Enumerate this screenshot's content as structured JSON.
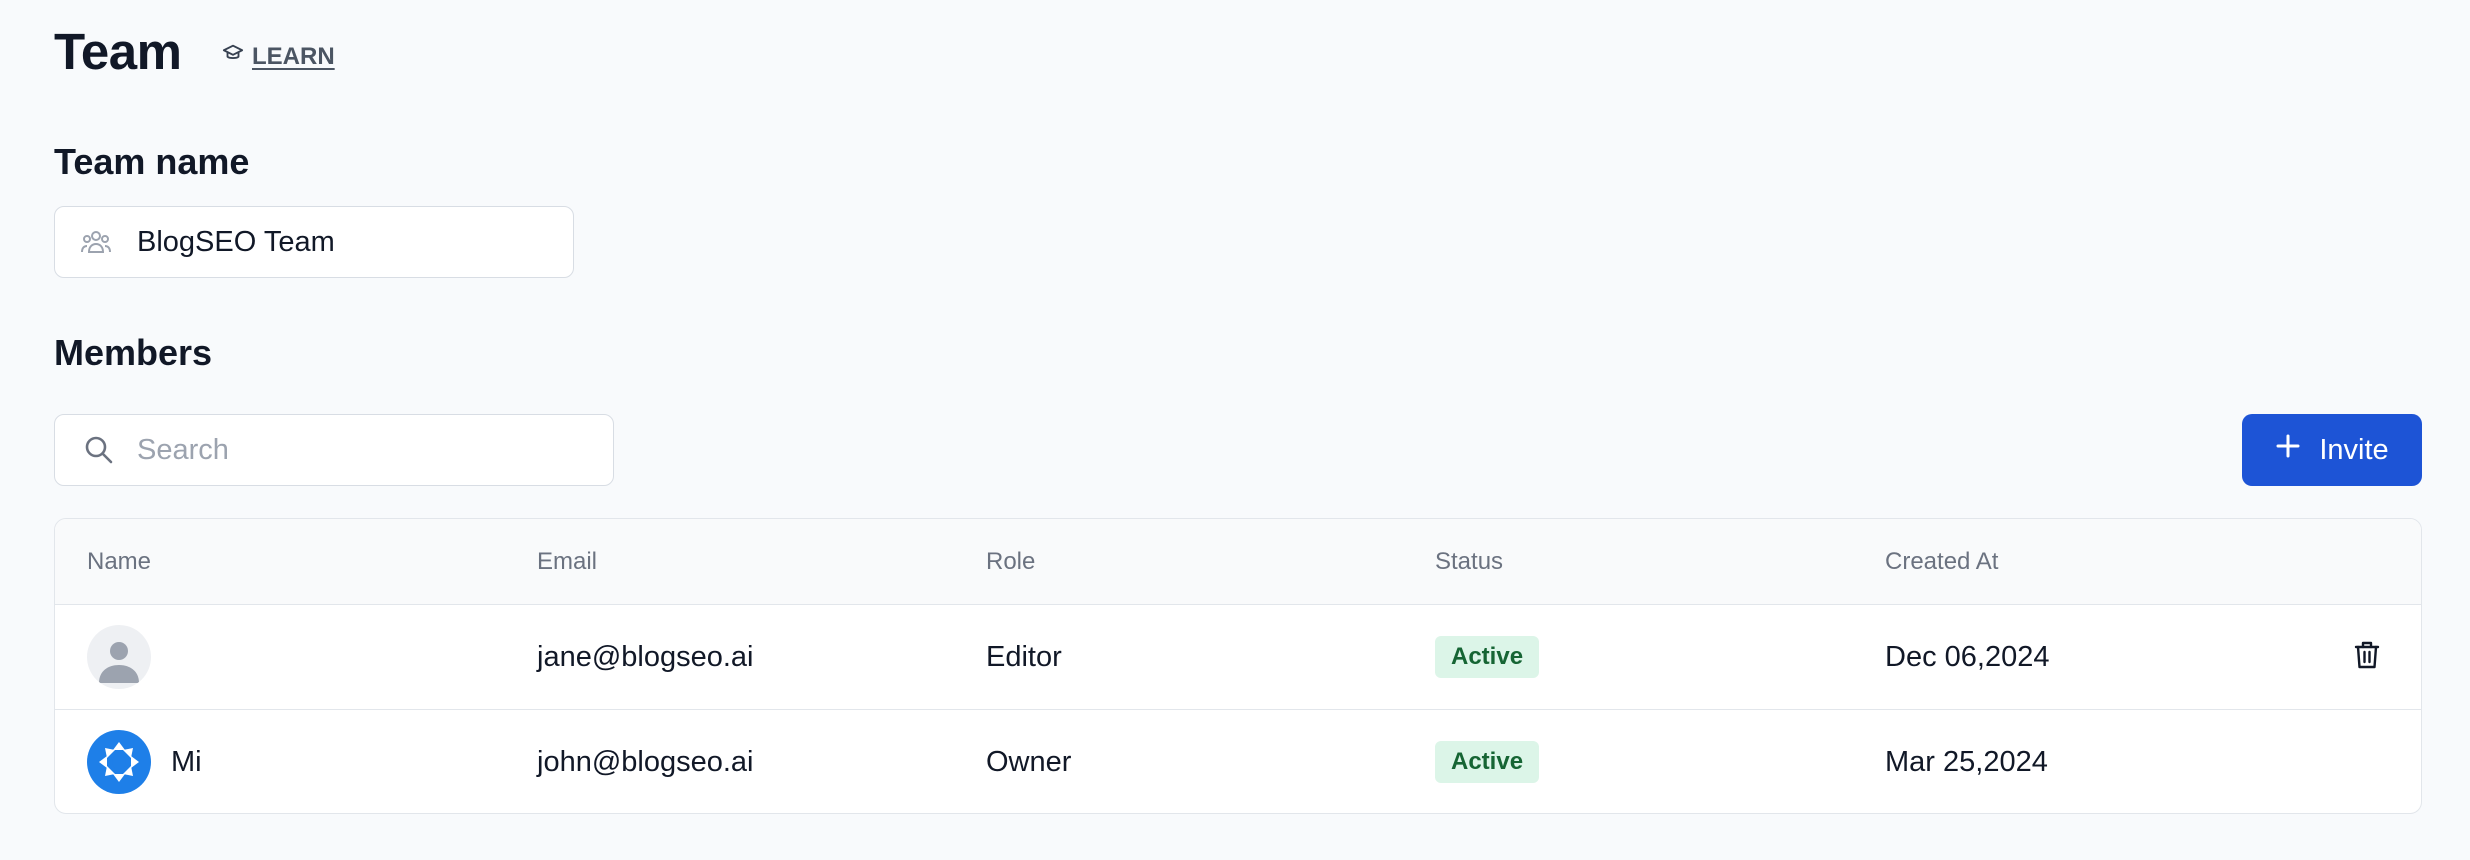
{
  "header": {
    "title": "Team",
    "learn_label": "LEARN",
    "learn_icon": "graduation-cap-icon"
  },
  "team_section": {
    "title": "Team name",
    "field_icon": "users-icon",
    "value": "BlogSEO Team"
  },
  "members_section": {
    "title": "Members",
    "search": {
      "placeholder": "Search",
      "value": "",
      "icon": "search-icon"
    },
    "invite_label": "Invite",
    "invite_icon": "plus-icon"
  },
  "table": {
    "columns": [
      "Name",
      "Email",
      "Role",
      "Status",
      "Created At"
    ],
    "rows": [
      {
        "name": "",
        "avatar": "user-placeholder-icon",
        "email": "jane@blogseo.ai",
        "role": "Editor",
        "status": "Active",
        "created_at": "Dec 06,2024",
        "action_icon": "trash-icon"
      },
      {
        "name": "Mi",
        "avatar": "logo-avatar",
        "email": "john@blogseo.ai",
        "role": "Owner",
        "status": "Active",
        "created_at": "Mar 25,2024"
      }
    ]
  },
  "colors": {
    "accent": "#1d54d6",
    "badge_bg": "#dcf5e8",
    "badge_text": "#166534",
    "background": "#f8fafc"
  }
}
